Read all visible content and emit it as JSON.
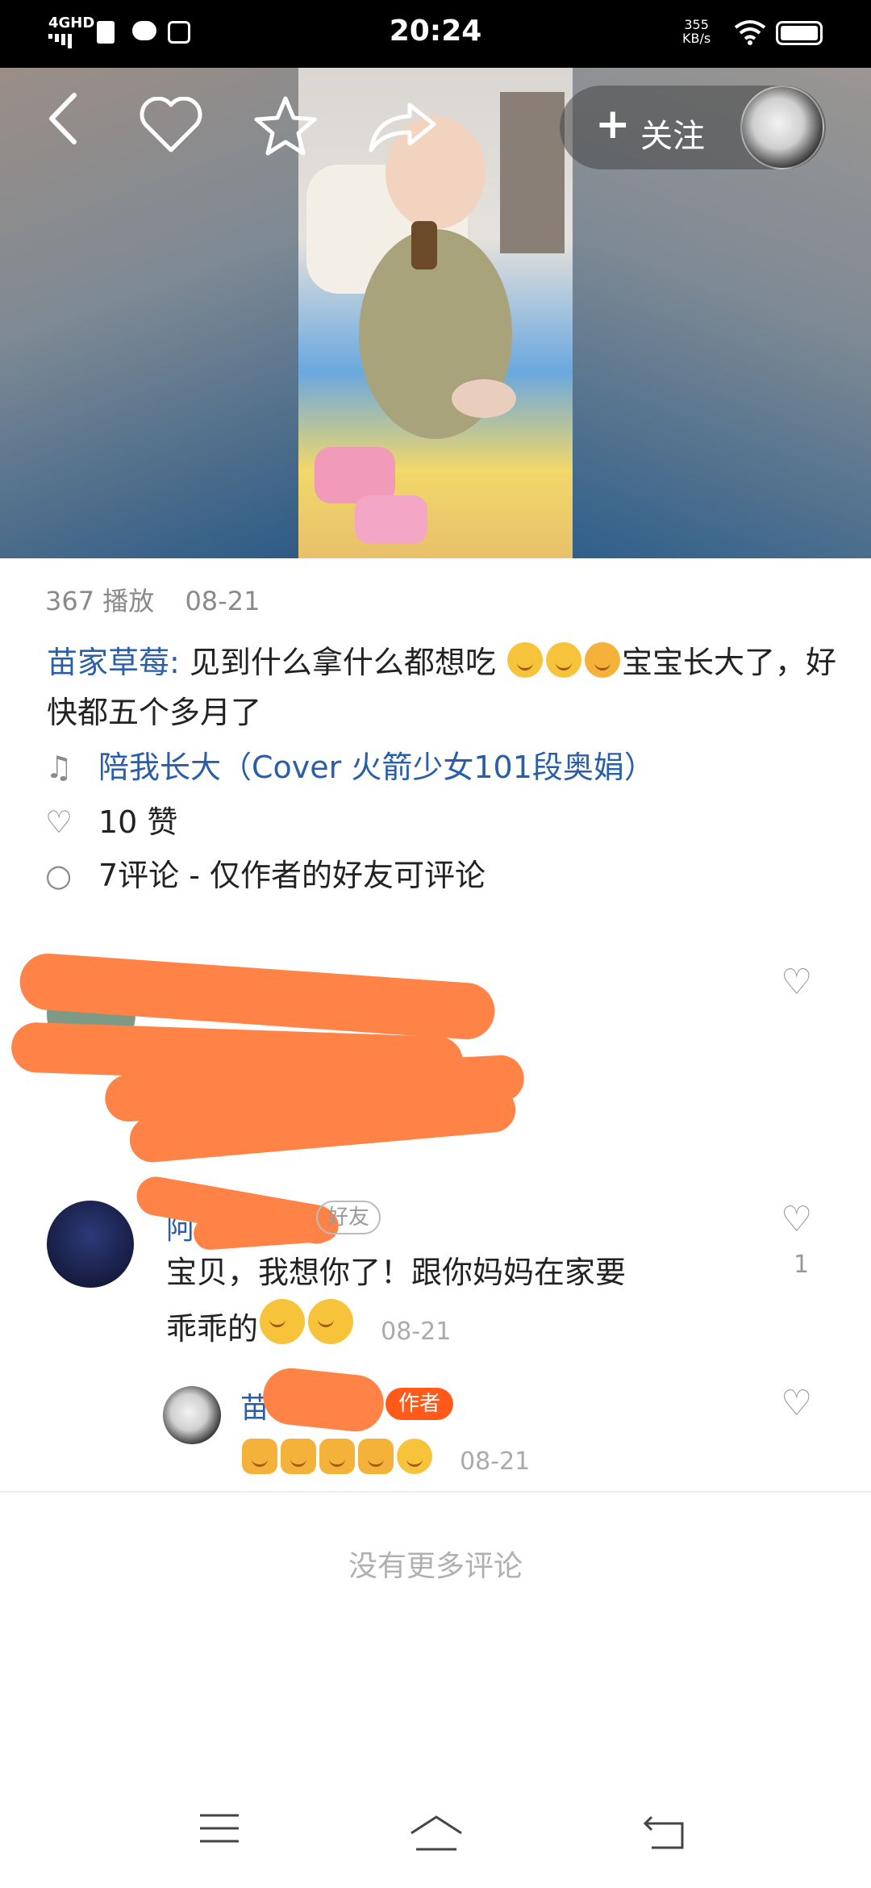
{
  "status_bar": {
    "time": "20:24",
    "network": "4GHD",
    "speed_value": "355",
    "speed_unit": "KB/s"
  },
  "video_header": {
    "follow_label": "关注"
  },
  "post": {
    "plays": "367 播放",
    "date": "08-21",
    "author": "苗家草莓:",
    "text_part1": " 见到什么拿什么都想吃 ",
    "text_part2": "宝宝长大了，好快都五个多月了",
    "music": "陪我长大（Cover 火箭少女101段奥娟）",
    "likes": "10 赞",
    "comments": "7评论 - 仅作者的好友可评论"
  },
  "comments": [
    {
      "name": "",
      "text": "",
      "date": ""
    },
    {
      "name": "阿",
      "badge": "好友",
      "text_line1": "宝贝，我想你了！跟你妈妈在家要",
      "text_line2": "乖乖的",
      "date": "08-21",
      "like_count": "1"
    },
    {
      "name": "苗",
      "badge": "作者",
      "date": "08-21"
    }
  ],
  "footer": {
    "no_more": "没有更多评论"
  }
}
